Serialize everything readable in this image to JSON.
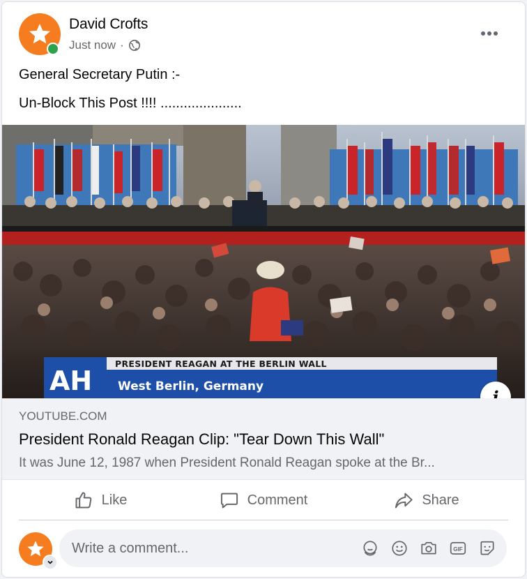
{
  "post": {
    "author": "David Crofts",
    "time": "Just now",
    "separator": "·",
    "privacy_icon": "globe-icon",
    "more_icon": "more-horizontal-icon",
    "text_lines": [
      "General Secretary Putin :-",
      "Un-Block This Post !!!! ....................."
    ]
  },
  "media": {
    "caption_banner": "PRESIDENT REAGAN AT THE BERLIN WALL",
    "location": "West Berlin, Germany",
    "logo_text": "AH",
    "info_icon": "info-icon"
  },
  "link_preview": {
    "domain": "YOUTUBE.COM",
    "title": "President Ronald Reagan Clip: \"Tear Down This Wall\"",
    "description": "It was June 12, 1987 when President Ronald Reagan spoke at the Br..."
  },
  "actions": {
    "like": "Like",
    "comment": "Comment",
    "share": "Share"
  },
  "composer": {
    "placeholder": "Write a comment...",
    "icons": [
      "avatar-sticker-icon",
      "emoji-icon",
      "camera-icon",
      "gif-icon",
      "sticker-icon"
    ]
  },
  "colors": {
    "avatar": "#f57c1f",
    "online": "#31a24c",
    "secondary_text": "#65676b"
  }
}
